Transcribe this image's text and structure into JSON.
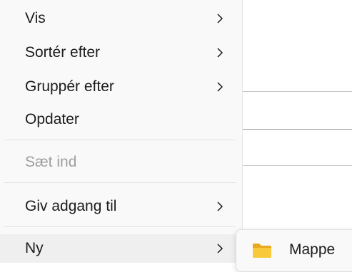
{
  "menu": {
    "items": [
      {
        "label": "Vis",
        "has_submenu": true,
        "enabled": true
      },
      {
        "label": "Sortér efter",
        "has_submenu": true,
        "enabled": true
      },
      {
        "label": "Gruppér efter",
        "has_submenu": true,
        "enabled": true
      },
      {
        "label": "Opdater",
        "has_submenu": false,
        "enabled": true
      },
      {
        "label": "Sæt ind",
        "has_submenu": false,
        "enabled": false
      },
      {
        "label": "Giv adgang til",
        "has_submenu": true,
        "enabled": true
      },
      {
        "label": "Ny",
        "has_submenu": true,
        "enabled": true,
        "highlighted": true
      }
    ]
  },
  "submenu": {
    "items": [
      {
        "label": "Mappe",
        "icon": "folder-icon"
      }
    ]
  },
  "colors": {
    "menu_background": "#f9f9f9",
    "hover_background": "#efefef",
    "text": "#1b1b1b",
    "disabled_text": "#9e9e9e",
    "folder_yellow": "#f8c93a"
  }
}
